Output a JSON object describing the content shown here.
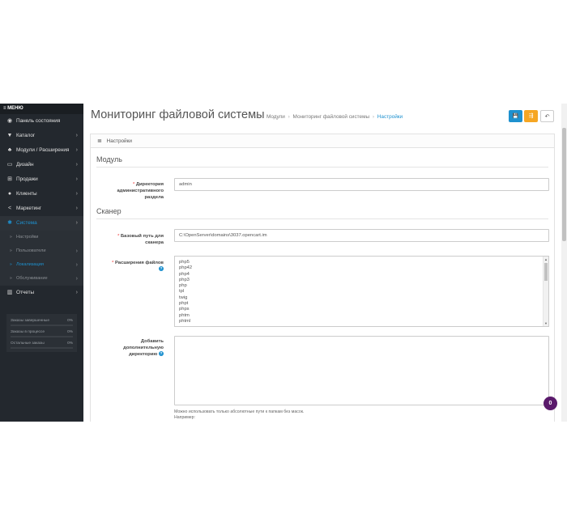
{
  "sidebar": {
    "menu_title": "≡ МЕНЮ",
    "items": [
      {
        "icon": "dashboard-icon",
        "glyph": "◉",
        "label": "Панель состояния"
      },
      {
        "icon": "tag-icon",
        "glyph": "▼",
        "label": "Каталог",
        "chevron": "›"
      },
      {
        "icon": "puzzle-icon",
        "glyph": "♣",
        "label": "Модули / Расширения",
        "chevron": "›"
      },
      {
        "icon": "monitor-icon",
        "glyph": "▭",
        "label": "Дизайн",
        "chevron": "›"
      },
      {
        "icon": "cart-icon",
        "glyph": "⊞",
        "label": "Продажи",
        "chevron": "›"
      },
      {
        "icon": "user-icon",
        "glyph": "●",
        "label": "Клиенты",
        "chevron": "›"
      },
      {
        "icon": "share-icon",
        "glyph": "<",
        "label": "Маркетинг",
        "chevron": "›"
      },
      {
        "icon": "gear-icon",
        "glyph": "✱",
        "label": "Система",
        "chevron": "›"
      }
    ],
    "subitems": [
      {
        "label": "Настройки",
        "chevron": ""
      },
      {
        "label": "Пользователи",
        "chevron": "›"
      },
      {
        "label": "Локализация",
        "chevron": "›"
      },
      {
        "label": "Обслуживание",
        "chevron": "›"
      }
    ],
    "reports": {
      "icon": "chart-icon",
      "glyph": "▥",
      "label": "Отчеты",
      "chevron": "›"
    },
    "stats": [
      {
        "label": "Заказы завершенные",
        "percent": "0%",
        "fill": 0
      },
      {
        "label": "Заказы в процессе",
        "percent": "0%",
        "fill": 0
      },
      {
        "label": "Остальные заказы",
        "percent": "0%",
        "fill": 0
      }
    ]
  },
  "header": {
    "title": "Мониторинг файловой системы",
    "breadcrumb": {
      "home_glyph": "⌂",
      "sep": "›",
      "items": [
        "Модули",
        "Мониторинг файловой системы",
        "Настройки"
      ]
    },
    "buttons": {
      "save_glyph": "💾",
      "share_glyph": "⇶",
      "back_glyph": "↶"
    }
  },
  "panel": {
    "heading_glyph": "≣",
    "heading": "Настройки",
    "module_section": "Модуль",
    "admin_dir_label": "Директория административного раздела",
    "admin_dir_value": "admin",
    "scanner_section": "Сканер",
    "base_path_label": "Базовый путь для сканера",
    "base_path_value": "C:\\OpenServer\\domains\\3037.opencart.im",
    "extensions_label": "Расширения файлов",
    "extensions": [
      "php5",
      "php42",
      "php4",
      "php3",
      "php",
      "tpl",
      "twig",
      "phpt",
      "phps",
      "phtm",
      "phtml"
    ],
    "extra_dirs_label": "Добавить дополнительную директорию",
    "extra_dirs_value": "",
    "hint_line1": "Можно использовать только абсолютные пути к папкам без масок.",
    "hint_line2": "Например:",
    "required_mark": "*",
    "help_glyph": "?"
  },
  "chat_badge": "0",
  "colors": {
    "accent": "#1e91cf",
    "warning": "#f6a623",
    "sidebar_bg": "#23282e",
    "required": "#f56b6b",
    "chat": "#5a1a6b"
  }
}
